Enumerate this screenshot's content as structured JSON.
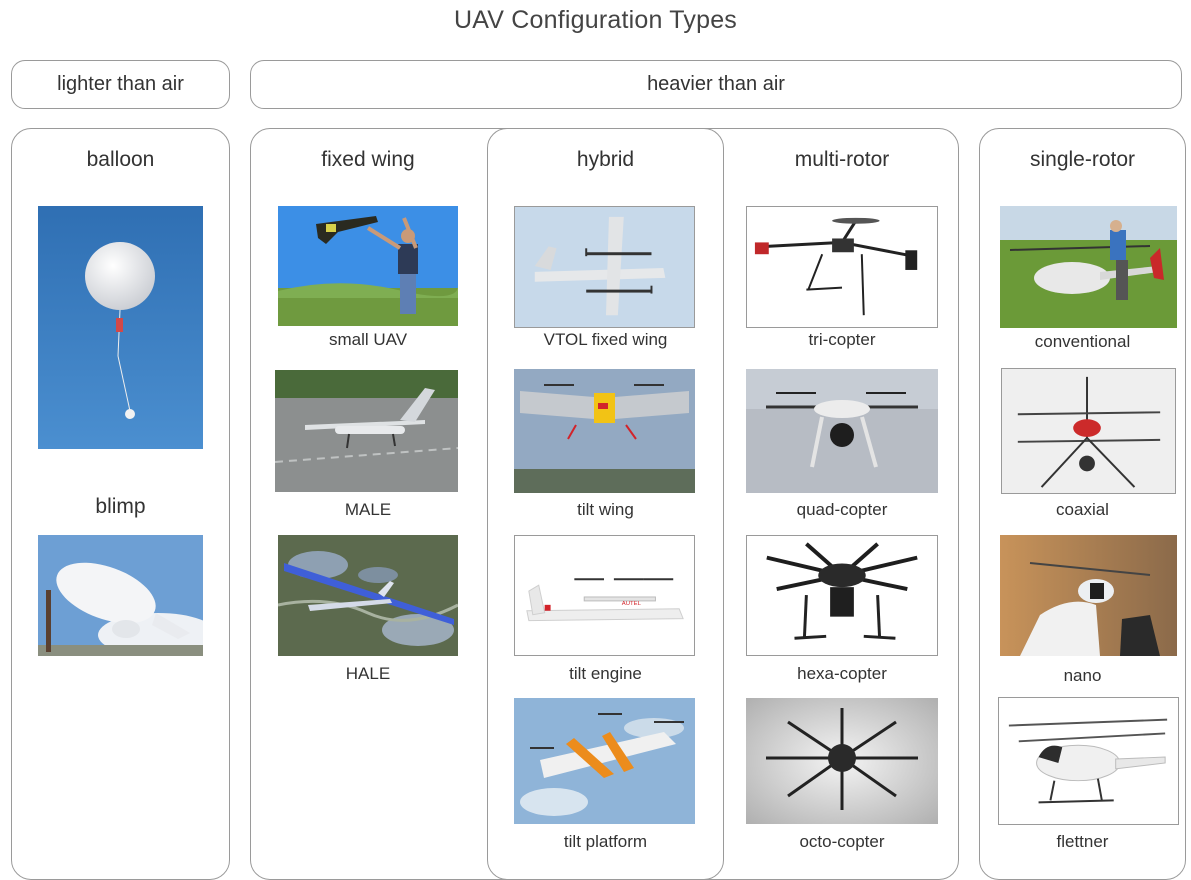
{
  "title": "UAV Configuration Types",
  "top_groups": {
    "lighter": "lighter than air",
    "heavier": "heavier than air"
  },
  "columns": {
    "balloon": "balloon",
    "blimp": "blimp",
    "fixed_wing": "fixed wing",
    "hybrid": "hybrid",
    "multi_rotor": "multi-rotor",
    "single_rotor": "single-rotor"
  },
  "labels": {
    "small_uav": "small UAV",
    "male": "MALE",
    "hale": "HALE",
    "vtol": "VTOL fixed wing",
    "tilt_wing": "tilt wing",
    "tilt_engine": "tilt engine",
    "tilt_platform": "tilt platform",
    "tri": "tri-copter",
    "quad": "quad-copter",
    "hexa": "hexa-copter",
    "octo": "octo-copter",
    "conventional": "conventional",
    "coaxial": "coaxial",
    "nano": "nano",
    "flettner": "flettner"
  }
}
